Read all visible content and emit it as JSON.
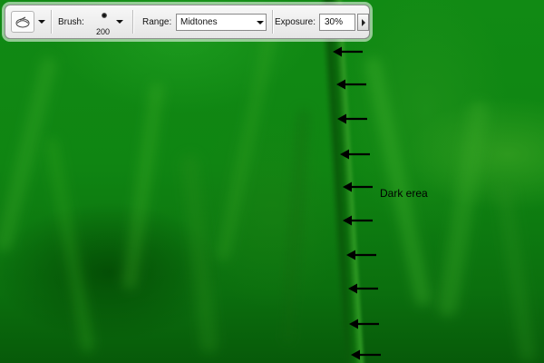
{
  "toolbar": {
    "tool_preset_icon": "dodge-tool-icon",
    "brush_label": "Brush:",
    "brush_size": "200",
    "range_label": "Range:",
    "range_value": "Midtones",
    "exposure_label": "Exposure:",
    "exposure_value": "30%"
  },
  "annotation": {
    "text": "Dark erea",
    "arrow_count": 10,
    "color": "#000000"
  },
  "colors": {
    "grass": "#0f8512",
    "stem_dark": "#0a5b0a",
    "toolbar_bg": "#ececec"
  }
}
